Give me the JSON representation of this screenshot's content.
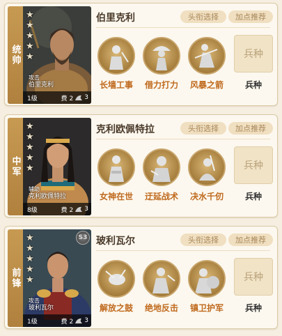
{
  "cards": [
    {
      "role": "统帅",
      "name": "伯里克利",
      "title_button": "头衔选择",
      "points_button": "加点推荐",
      "skill_caption_top": "攻击",
      "skill_caption_name": "伯里克利",
      "level": "1级",
      "cost": "费 2",
      "count": "3",
      "has_s3": false,
      "skills": [
        "长墙工事",
        "借力打力",
        "风暴之箭"
      ],
      "troop_box": "兵种",
      "troop_label": "兵种"
    },
    {
      "role": "中军",
      "name": "克利欧佩特拉",
      "title_button": "头衔选择",
      "points_button": "加点推荐",
      "skill_caption_top": "辅助",
      "skill_caption_name": "克利欧佩特拉",
      "level": "8级",
      "cost": "费 2",
      "count": "3",
      "has_s3": false,
      "skills": [
        "女神在世",
        "迂延战术",
        "决水千仞"
      ],
      "troop_box": "兵种",
      "troop_label": "兵种"
    },
    {
      "role": "前锋",
      "name": "玻利瓦尔",
      "title_button": "头衔选择",
      "points_button": "加点推荐",
      "skill_caption_top": "攻击",
      "skill_caption_name": "玻利瓦尔",
      "level": "1级",
      "cost": "费 2",
      "count": "3",
      "has_s3": true,
      "s3_label": "S3",
      "skills": [
        "解放之鼓",
        "绝地反击",
        "镇卫护军"
      ],
      "troop_box": "兵种",
      "troop_label": "兵种"
    }
  ]
}
